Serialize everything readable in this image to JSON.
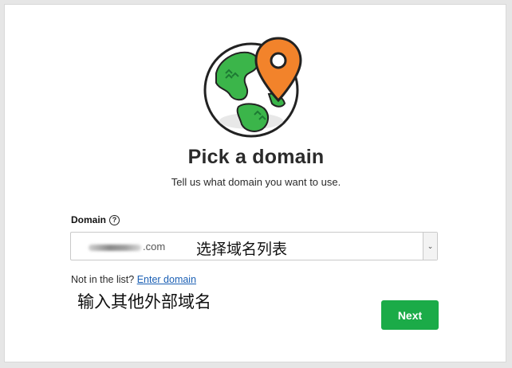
{
  "header": {
    "title": "Pick a domain",
    "subtitle": "Tell us what domain you want to use."
  },
  "illustration": {
    "icon": "globe-with-map-pin",
    "colors": {
      "land": "#3bb54a",
      "ocean": "#ffffff",
      "pin": "#f2832b",
      "outline": "#222222"
    }
  },
  "domain_field": {
    "label": "Domain",
    "help_icon": "?",
    "selected_value": ".com",
    "annotation": "选择域名列表",
    "dropdown_icon": "⌄"
  },
  "alternate": {
    "prompt": "Not in the list?",
    "link_label": "Enter domain",
    "annotation": "输入其他外部域名"
  },
  "actions": {
    "next_label": "Next",
    "next_color": "#1bab48"
  }
}
